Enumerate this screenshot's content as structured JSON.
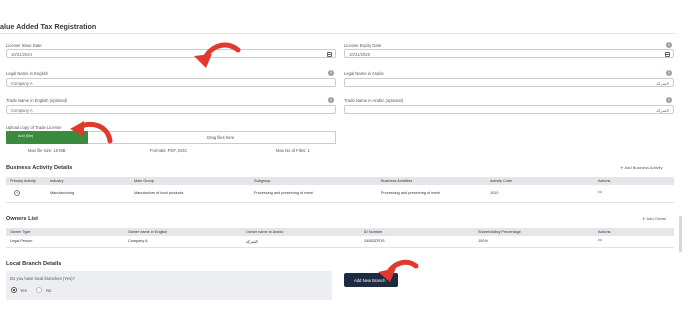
{
  "page": {
    "title": "alue Added Tax Registration"
  },
  "license_issue_date": {
    "label": "License Issue Date",
    "value": "10/31/2024"
  },
  "license_expiry_date": {
    "label": "License Expiry Date",
    "value": "10/31/2025"
  },
  "legal_name_en": {
    "label": "Legal Name in English",
    "value": "Company A"
  },
  "legal_name_ar": {
    "label": "Legal Name in Arabic",
    "value": "الشركة"
  },
  "trade_name_en": {
    "label": "Trade Name in English (optional)",
    "value": "Company A"
  },
  "trade_name_ar": {
    "label": "Trade Name in Arabic (optional)",
    "value": "الشركة"
  },
  "upload": {
    "label": "Upload copy of Trade License",
    "add_button": "Add (file)",
    "drop_text": "Drag files here",
    "max_size": "Max file size: 10 MB",
    "formats": "Formats: PDF, DOC",
    "max_files": "Max No of Files: 1"
  },
  "business_activity": {
    "title": "Business Activity Details",
    "add_label": "Add Business Activity",
    "headers": [
      "Primary Activity",
      "Industry",
      "Main Group",
      "Subgroup",
      "Business Activities",
      "Activity Code",
      "Actions"
    ],
    "rows": [
      {
        "industry": "Manufacturing",
        "main_group": "Manufacture of food products",
        "subgroup": "Processing and preserving of meat",
        "activities": "Processing and preserving of meat",
        "code": "1010",
        "actions": "•••"
      }
    ]
  },
  "owners": {
    "title": "Owners List",
    "add_label": "Add Owner",
    "headers": [
      "Owner Type",
      "Owner name in English",
      "Owner name in Arabic",
      "ID Number",
      "Shareholding Percentage",
      "Actions"
    ],
    "rows": [
      {
        "type": "Legal Person",
        "name_en": "Company A",
        "name_ar": "الشركة",
        "id": "24083ZFDS",
        "share": "100%",
        "actions": "•••"
      }
    ]
  },
  "local_branch": {
    "title": "Local Branch Details",
    "question": "Do you have local branches (Yes)?",
    "yes": "Yes",
    "no": "No",
    "selected": "Yes",
    "add_button": "Add New Branch"
  },
  "colors": {
    "accent_red": "#e03a2f",
    "green": "#3a8b3e",
    "navy": "#1d2b40"
  }
}
